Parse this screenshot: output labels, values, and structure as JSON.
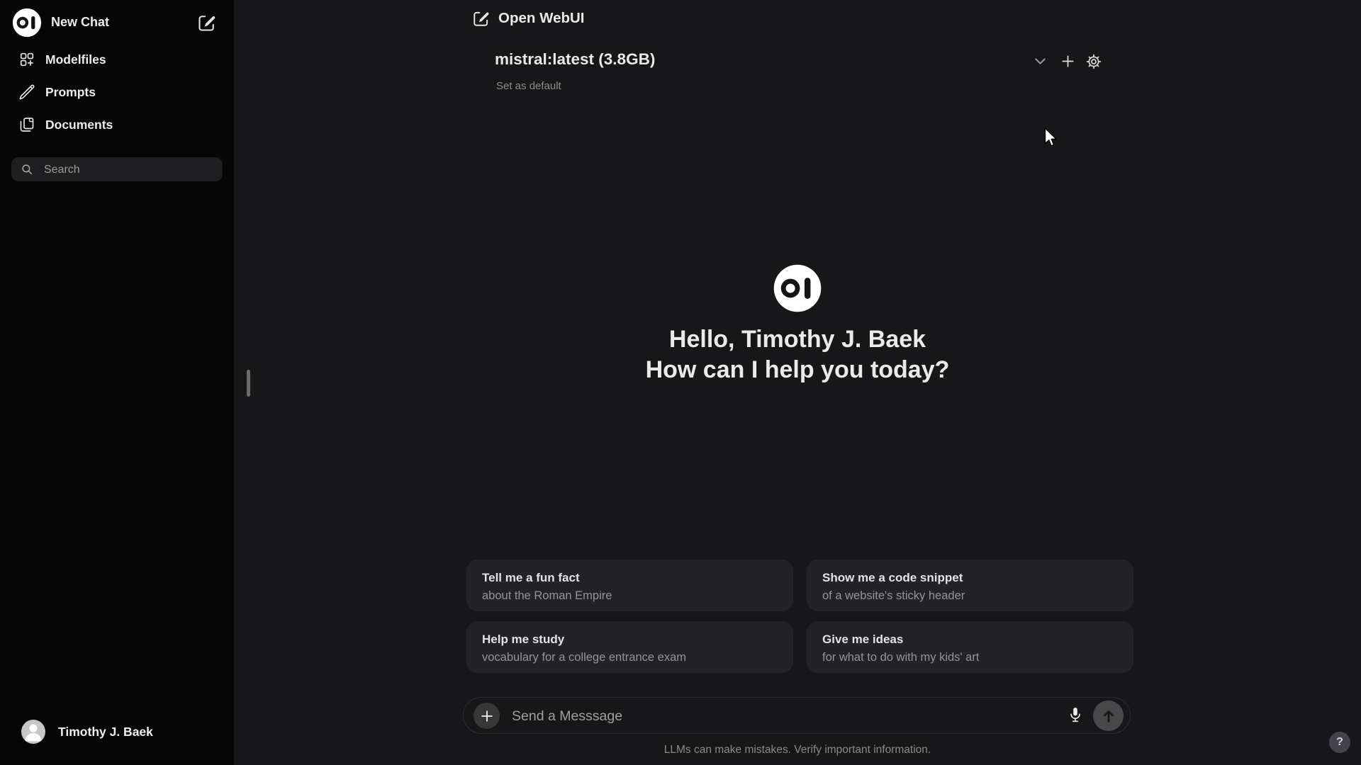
{
  "app": {
    "title": "Open WebUI"
  },
  "sidebar": {
    "new_chat": "New Chat",
    "items": [
      {
        "label": "Modelfiles"
      },
      {
        "label": "Prompts"
      },
      {
        "label": "Documents"
      }
    ],
    "search_placeholder": "Search",
    "user_name": "Timothy J. Baek"
  },
  "model_bar": {
    "model_name": "mistral:latest (3.8GB)",
    "set_default": "Set as default"
  },
  "hero": {
    "greeting_line1": "Hello, Timothy J. Baek",
    "greeting_line2": "How can I help you today?"
  },
  "suggestions": [
    {
      "title": "Tell me a fun fact",
      "subtitle": "about the Roman Empire"
    },
    {
      "title": "Show me a code snippet",
      "subtitle": "of a website's sticky header"
    },
    {
      "title": "Help me study",
      "subtitle": "vocabulary for a college entrance exam"
    },
    {
      "title": "Give me ideas",
      "subtitle": "for what to do with my kids' art"
    }
  ],
  "composer": {
    "placeholder": "Send a Messsage",
    "disclaimer": "LLMs can make mistakes. Verify important information."
  },
  "help_button": "?",
  "colors": {
    "sidebar_bg": "#060606",
    "main_bg": "#17171a",
    "card_bg": "#232327",
    "search_bg": "#1f1f22",
    "primary_text": "#ececec",
    "muted_text": "#949494"
  }
}
